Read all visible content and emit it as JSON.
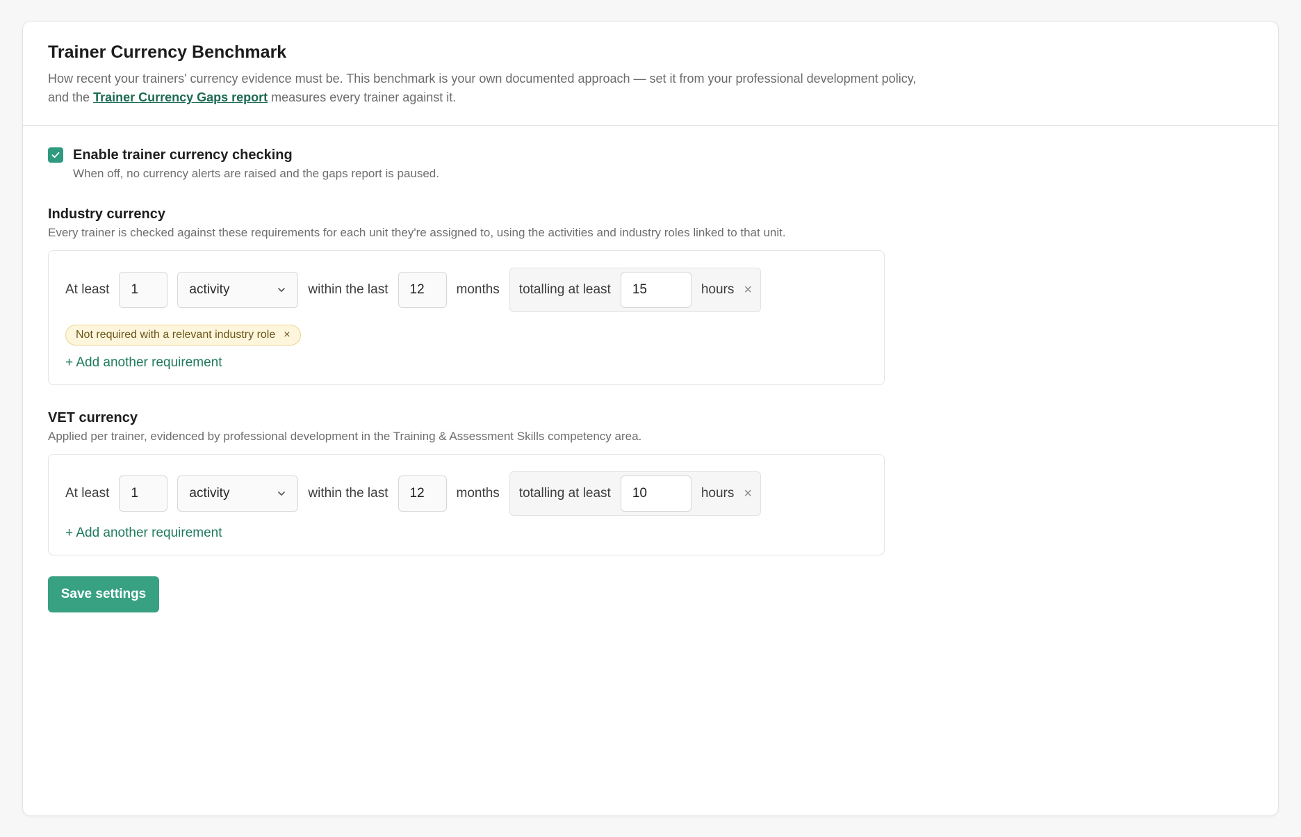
{
  "header": {
    "title": "Trainer Currency Benchmark",
    "desc_before": "How recent your trainers' currency evidence must be. This benchmark is your own documented approach — set it from your professional development policy, and the ",
    "desc_link": "Trainer Currency Gaps report",
    "desc_after": " measures every trainer against it."
  },
  "toggle": {
    "checked": true,
    "label": "Enable trainer currency checking",
    "help": "When off, no currency alerts are raised and the gaps report is paused."
  },
  "industry": {
    "title": "Industry currency",
    "desc": "Every trainer is checked against these requirements for each unit they're assigned to, using the activities and industry roles linked to that unit.",
    "req": {
      "at_least": "At least",
      "count": "1",
      "unit": "activity",
      "within": "within the last",
      "months_value": "12",
      "months": "months",
      "totalling": "totalling at least",
      "hours_value": "15",
      "hours": "hours",
      "remove": "×"
    },
    "chip": {
      "label": "Not required with a relevant industry role",
      "remove": "×"
    },
    "add": "+ Add another requirement"
  },
  "vet": {
    "title": "VET currency",
    "desc": "Applied per trainer, evidenced by professional development in the Training & Assessment Skills competency area.",
    "req": {
      "at_least": "At least",
      "count": "1",
      "unit": "activity",
      "within": "within the last",
      "months_value": "12",
      "months": "months",
      "totalling": "totalling at least",
      "hours_value": "10",
      "hours": "hours",
      "remove": "×"
    },
    "add": "+ Add another requirement"
  },
  "save_label": "Save settings",
  "colors": {
    "accent": "#38a182",
    "link": "#1d6b53",
    "chip_bg": "#fdf6dd",
    "chip_border": "#ecd48b"
  }
}
